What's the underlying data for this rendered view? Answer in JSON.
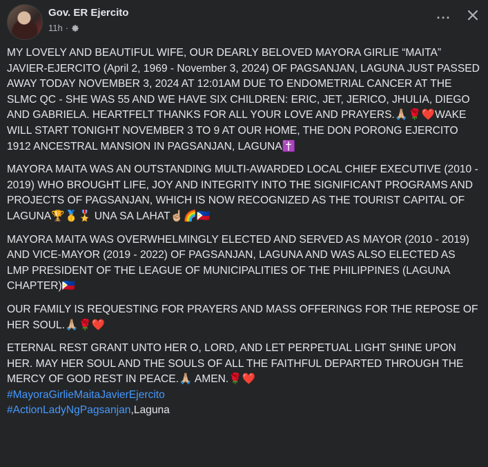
{
  "post": {
    "author": "Gov. ER Ejercito",
    "time": "11h",
    "more_label": "···",
    "close_label": "✕",
    "paragraphs": [
      "MY LOVELY AND BEAUTIFUL WIFE, OUR DEARLY BELOVED MAYORA GIRLIE “MAITA” JAVIER-EJERCITO (April 2, 1969 - November 3, 2024) OF PAGSANJAN, LAGUNA JUST PASSED AWAY TODAY NOVEMBER 3, 2024 AT 12:01AM DUE TO ENDOMETRIAL CANCER AT THE  SLMC QC - SHE WAS 55 AND WE HAVE SIX CHILDREN: ERIC, JET, JERICO, JHULIA, DIEGO AND GABRIELA. HEARTFELT THANKS FOR ALL YOUR LOVE AND PRAYERS.🙏🏼🌹❤️WAKE WILL START TONIGHT NOVEMBER 3 TO 9 AT OUR HOME, THE DON PORONG EJERCITO 1912 ANCESTRAL MANSION IN PAGSANJAN, LAGUNA✝️",
      "MAYORA MAITA WAS AN OUTSTANDING MULTI-AWARDED LOCAL CHIEF EXECUTIVE (2010 - 2019) WHO BROUGHT LIFE, JOY AND INTEGRITY INTO THE SIGNIFICANT PROGRAMS AND PROJECTS OF PAGSANJAN, WHICH IS NOW RECOGNIZED AS THE TOURIST CAPITAL OF LAGUNA🏆🥇🎖️ UNA SA LAHAT☝🏼🌈🇵🇭",
      "MAYORA MAITA WAS OVERWHELMINGLY ELECTED AND SERVED AS MAYOR (2010 - 2019) AND VICE-MAYOR (2019 - 2022) OF PAGSANJAN, LAGUNA AND WAS ALSO ELECTED AS LMP PRESIDENT OF THE LEAGUE OF MUNICIPALITIES OF THE PHILIPPINES (LAGUNA CHAPTER)🇵🇭",
      "OUR FAMILY IS REQUESTING FOR PRAYERS AND MASS OFFERINGS FOR THE REPOSE OF HER SOUL.🙏🏼🌹❤️",
      "ETERNAL REST GRANT UNTO HER O, LORD, AND LET PERPETUAL LIGHT SHINE UPON HER. MAY HER SOUL AND THE SOULS OF ALL THE FAITHFUL DEPARTED THROUGH THE MERCY OF GOD REST IN PEACE.🙏🏼 AMEN.🌹❤️"
    ],
    "hashtag_1": "#MayoraGirlieMaitaJavierEjercito",
    "hashtag_2": "#ActionLadyNgPagsanjan",
    "hashtag_2_suffix": ",Laguna"
  },
  "icons": {
    "avatar": "profile-photo",
    "privacy": "gear-icon",
    "more": "more-options-icon",
    "close": "close-icon"
  },
  "colors": {
    "background": "#242526",
    "text": "#e4e6eb",
    "secondary_text": "#b0b3b8",
    "hashtag": "#4599ff"
  }
}
